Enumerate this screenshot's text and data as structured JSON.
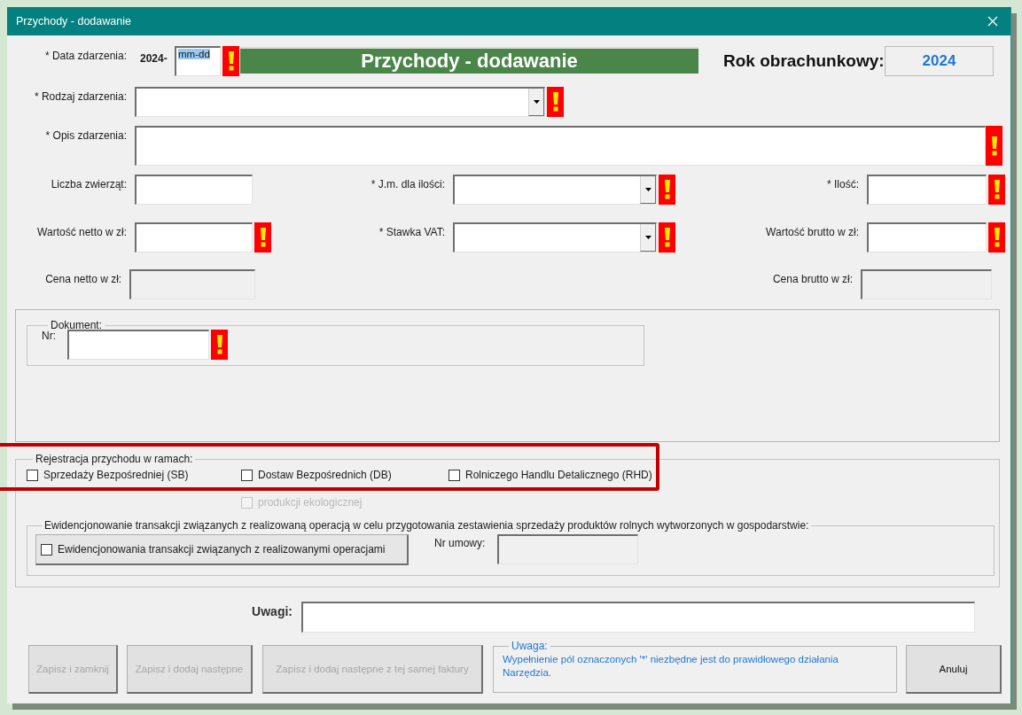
{
  "window": {
    "title": "Przychody - dodawanie"
  },
  "date": {
    "label": "* Data zdarzenia:",
    "prefix": "2024-",
    "value": "mm-dd",
    "value_selected": true,
    "warning": true
  },
  "banner": "Przychody - dodawanie",
  "fiscal_year": {
    "label": "Rok obrachunkowy:",
    "value": "2024"
  },
  "event_type": {
    "label": "* Rodzaj zdarzenia:",
    "kind": "combo",
    "warning": true,
    "disabled": false
  },
  "description": {
    "label": "* Opis zdarzenia:",
    "kind": "textarea",
    "warning": true,
    "disabled": false
  },
  "rows": [
    {
      "left": {
        "label": "Liczba zwierząt:",
        "kind": "text",
        "warning": false,
        "disabled": false
      },
      "middle": {
        "label": "* J.m. dla ilości:",
        "kind": "combo",
        "warning": true,
        "disabled": false
      },
      "right": {
        "label": "* Ilość:",
        "kind": "text",
        "warning": true,
        "disabled": false
      }
    },
    {
      "left": {
        "label": "Wartość netto w zł:",
        "kind": "text",
        "warning": true,
        "disabled": false
      },
      "middle": {
        "label": "* Stawka VAT:",
        "kind": "combo",
        "warning": true,
        "disabled": false
      },
      "right": {
        "label": "Wartość brutto w zł:",
        "kind": "text",
        "warning": true,
        "disabled": false
      }
    },
    {
      "left": {
        "label": "Cena netto w zł:",
        "kind": "text",
        "warning": false,
        "disabled": true
      },
      "right": {
        "label": "Cena brutto w zł:",
        "kind": "text",
        "warning": false,
        "disabled": true
      }
    }
  ],
  "document": {
    "legend": "Dokument:",
    "label": "Nr:",
    "warning": true
  },
  "registration": {
    "legend": "Rejestracja przychodu w ramach:",
    "options": [
      {
        "label": "Sprzedaży Bezpośredniej (SB)",
        "checked": false,
        "disabled": false
      },
      {
        "label": "Dostaw Bezpośrednich (DB)",
        "checked": false,
        "disabled": false
      },
      {
        "label": "Rolniczego Handlu Detalicznego (RHD)",
        "checked": false,
        "disabled": false
      },
      {
        "label": "produkcji ekologicznej",
        "checked": false,
        "disabled": true
      }
    ],
    "records": {
      "legend": "Ewidencjonowanie transakcji związanych z realizowaną operacją w celu przygotowania zestawienia sprzedaży produktów rolnych wytworzonych w gospodarstwie:",
      "toggle": {
        "label": "Ewidencjonowania transakcji związanych z realizowanymi operacjami",
        "checked": false
      },
      "contract": {
        "label": "Nr umowy:",
        "disabled": true
      }
    }
  },
  "notes": {
    "label": "Uwagi:"
  },
  "buttons": [
    {
      "label": "Zapisz i zamknij",
      "disabled": true
    },
    {
      "label": "Zapisz i dodaj następne",
      "disabled": true
    },
    {
      "label": "Zapisz i dodaj następne z tej samej faktury",
      "disabled": true
    }
  ],
  "notice": {
    "legend": "Uwaga:",
    "text": "Wypełnienie pól oznaczonych '*' niezbędne jest do prawidłowego działania Narzędzia."
  },
  "cancel": {
    "label": "Anuluj",
    "disabled": false
  }
}
